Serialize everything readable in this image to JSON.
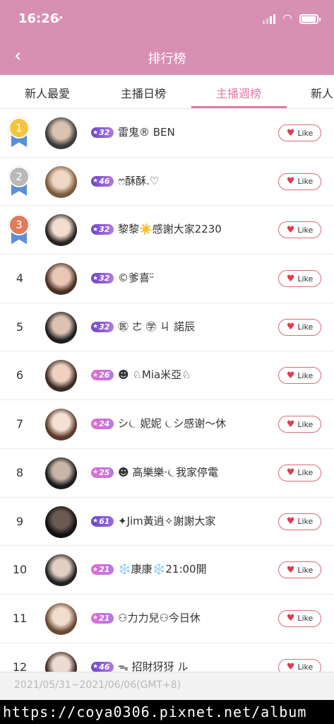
{
  "status_bar": {
    "time": "16:26",
    "location_glyph": "➚"
  },
  "nav": {
    "back_glyph": "‹",
    "title": "排行榜"
  },
  "tabs": [
    {
      "label": "新人最愛",
      "active": false
    },
    {
      "label": "主播日榜",
      "active": false
    },
    {
      "label": "主播週榜",
      "active": true
    },
    {
      "label": "新人",
      "active": false
    }
  ],
  "like_label": "Like",
  "colors": {
    "header": "#d88fb4",
    "accent": "#e07aa8",
    "medal_gold": "#f4c542",
    "medal_silver": "#b9b9b9",
    "medal_bronze": "#e07b5c",
    "ribbon": "#5b8fd8",
    "badge_a": "#b27ae3",
    "badge_b": "#e36bd0",
    "badge_dark": "#6a45c6"
  },
  "rows": [
    {
      "rank": "1",
      "medal": "gold",
      "level": "32",
      "name": "雷鬼® BEN"
    },
    {
      "rank": "2",
      "medal": "silver",
      "level": "46",
      "name": "ෆ酥酥.♡"
    },
    {
      "rank": "3",
      "medal": "bronze",
      "level": "32",
      "name": "黎黎☀️感謝大家2230"
    },
    {
      "rank": "4",
      "medal": "",
      "level": "32",
      "name": "©爹喜ᵕ̈"
    },
    {
      "rank": "5",
      "medal": "",
      "level": "32",
      "name": "㊩ ㄜ ㊫ ㄐ 諾辰"
    },
    {
      "rank": "6",
      "medal": "",
      "level": "26",
      "name": "☻ ♘Mia米亞♘"
    },
    {
      "rank": "7",
      "medal": "",
      "level": "24",
      "name": "シ⏾ 妮妮 ⏾シ感谢～休"
    },
    {
      "rank": "8",
      "medal": "",
      "level": "25",
      "name": "☻ 高樂樂·⏾我家停電"
    },
    {
      "rank": "9",
      "medal": "",
      "level": "61",
      "name": "✦Jim黃逍✧謝謝大家"
    },
    {
      "rank": "10",
      "medal": "",
      "level": "21",
      "name": "❄️康康❄️21:00開"
    },
    {
      "rank": "11",
      "medal": "",
      "level": "21",
      "name": "⚇力力兒⚇今日休"
    },
    {
      "rank": "12",
      "medal": "",
      "level": "46",
      "name": "ᯓ 招財犽犽 ル"
    }
  ],
  "footer": {
    "date_range": "2021/05/31~2021/06/06(GMT+8)"
  },
  "watermark": "https://coya0306.pixnet.net/album"
}
